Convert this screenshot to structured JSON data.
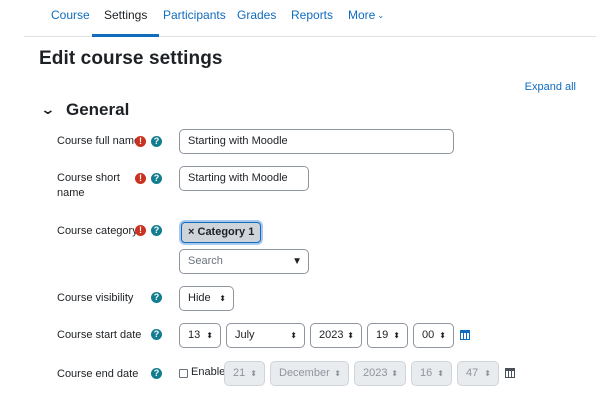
{
  "nav": {
    "tabs": [
      {
        "label": "Course"
      },
      {
        "label": "Settings"
      },
      {
        "label": "Participants"
      },
      {
        "label": "Grades"
      },
      {
        "label": "Reports"
      },
      {
        "label": "More"
      }
    ],
    "active_tab": "Settings"
  },
  "page": {
    "title": "Edit course settings",
    "expand_all": "Expand all"
  },
  "section": {
    "title": "General"
  },
  "fields": {
    "full_name": {
      "label": "Course full name",
      "value": "Starting with Moodle"
    },
    "short_name": {
      "label_line1": "Course short",
      "label_line2": "name",
      "value": "Starting with Moodle"
    },
    "category": {
      "label": "Course category",
      "tag": "Category 1",
      "tag_remove": "×",
      "search_placeholder": "Search"
    },
    "visibility": {
      "label": "Course visibility",
      "value": "Hide"
    },
    "start_date": {
      "label": "Course start date",
      "day": "13",
      "month": "July",
      "year": "2023",
      "hour": "19",
      "minute": "00"
    },
    "end_date": {
      "label": "Course end date",
      "enable_label": "Enable",
      "enabled": false,
      "day": "21",
      "month": "December",
      "year": "2023",
      "hour": "16",
      "minute": "47"
    }
  },
  "icons": {
    "required": "!",
    "help": "?",
    "select_arrows": "⬍",
    "dropdown_triangle": "▼"
  },
  "colors": {
    "accent": "#0f6cbf",
    "required": "#ca3120",
    "help": "#127d8f",
    "disabled_bg": "#e9ecef"
  }
}
